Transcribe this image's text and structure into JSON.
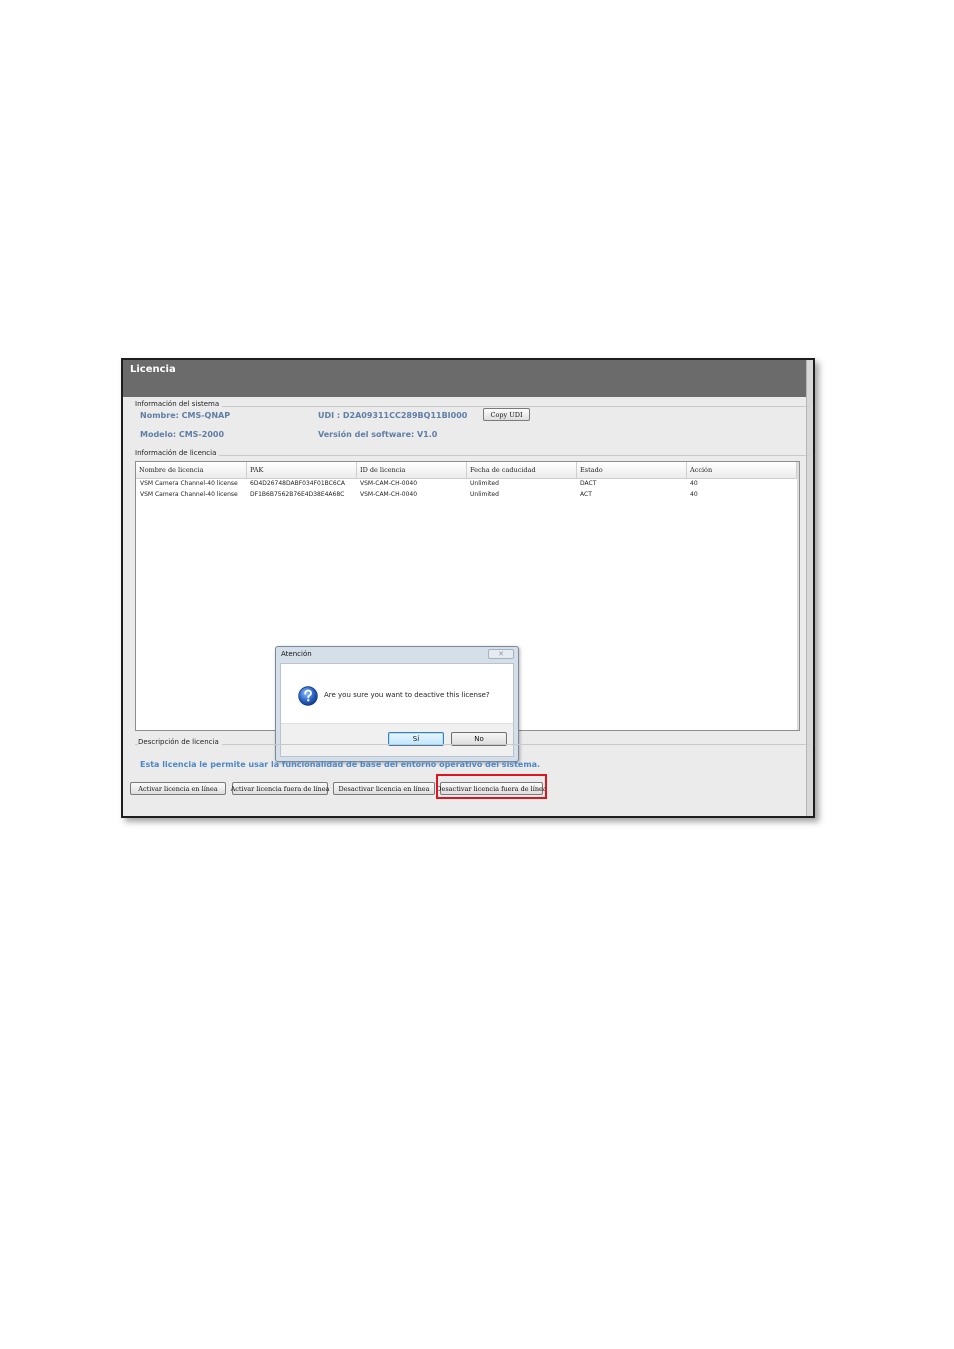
{
  "window": {
    "title": "Licencia"
  },
  "system_info": {
    "group_label": "Información del sistema",
    "name": "Nombre: CMS-QNAP",
    "udi": "UDI : D2A09311CC289BQ11BI000",
    "copy_udi_label": "Copy UDI",
    "model": "Modelo: CMS-2000",
    "software_version": "Versión del software: V1.0"
  },
  "license_info": {
    "group_label": "Información de licencia",
    "columns": [
      "Nombre de licencia",
      "PAK",
      "ID de licencia",
      "Fecha de caducidad",
      "Estado",
      "Acción"
    ],
    "rows": [
      [
        "VSM Camera Channel-40 license",
        "6D4D26748DABF034F01BC6CA",
        "VSM-CAM-CH-0040",
        "Unlimited",
        "DACT",
        "40"
      ],
      [
        "VSM Camera Channel-40 license",
        "DF1B6B7562B76E4D38E4A68C",
        "VSM-CAM-CH-0040",
        "Unlimited",
        "ACT",
        "40"
      ]
    ]
  },
  "dialog": {
    "title": "Atención",
    "close_glyph": "✕",
    "message": "Are you sure you want to deactive this license?",
    "yes_label": "Sí",
    "no_label": "No"
  },
  "description": {
    "group_label": "Descripción de licencia",
    "text": "Esta licencia le permite usar la funcionalidad de base del entorno operativo del sistema."
  },
  "actions": {
    "activate_online": "Activar licencia en línea",
    "activate_offline": "Activar licencia fuera de línea",
    "deactivate_online": "Desactivar licencia en línea",
    "deactivate_offline": "Desactivar licencia fuera de línea"
  },
  "colors": {
    "titlebar": "#6b6b6b",
    "info_text": "#5f7ea6",
    "description_text": "#4d87c5",
    "highlight_box": "#e0141e"
  }
}
